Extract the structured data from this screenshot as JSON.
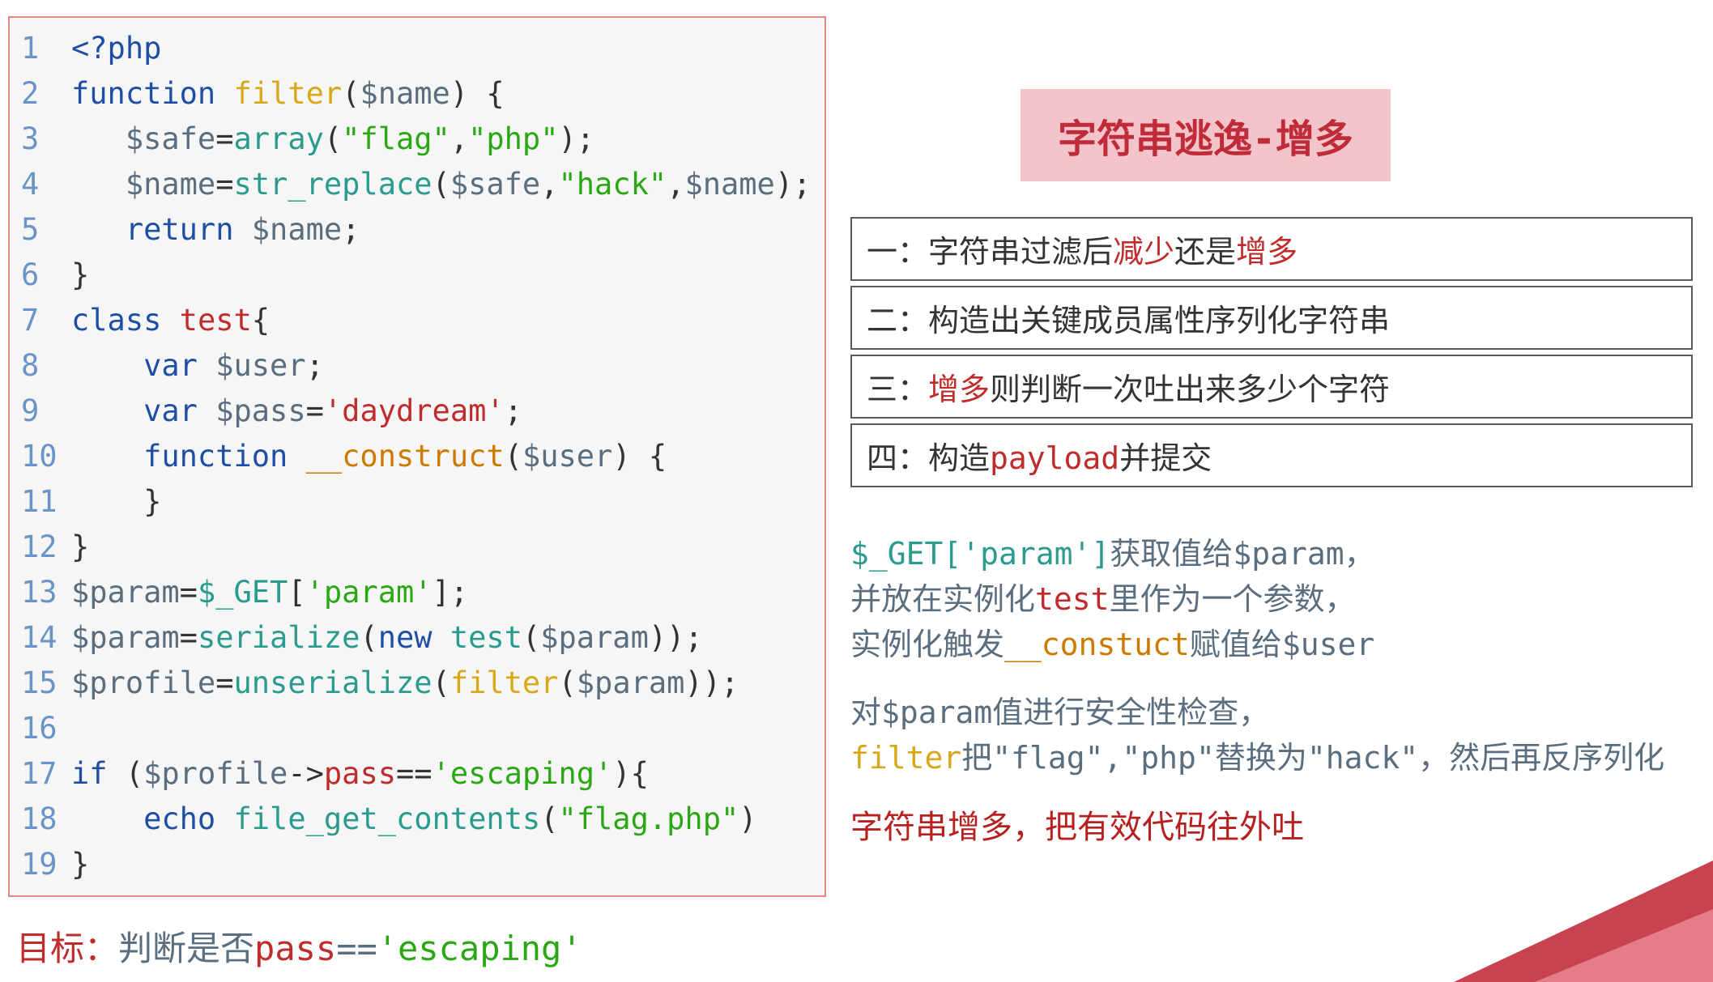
{
  "title_badge": "字符串逃逸-增多",
  "code": {
    "rows": [
      {
        "n": "1",
        "html": "<span class='kw-blue'>&lt;?php</span>"
      },
      {
        "n": "2",
        "html": "<span class='kw-blue'>function</span> <span class='name-gold'>filter</span>(<span class='var-slate'>$name</span>) {"
      },
      {
        "n": "3",
        "html": "   <span class='var-slate'>$safe</span>=<span class='fn-teal'>array</span>(<span class='str-green'>\"flag\"</span>,<span class='str-green'>\"php\"</span>);"
      },
      {
        "n": "4",
        "html": "   <span class='var-slate'>$name</span>=<span class='fn-teal'>str_replace</span>(<span class='var-slate'>$safe</span>,<span class='str-green'>\"hack\"</span>,<span class='var-slate'>$name</span>);"
      },
      {
        "n": "5",
        "html": "   <span class='kw-blue'>return</span> <span class='var-slate'>$name</span>;"
      },
      {
        "n": "6",
        "html": "}"
      },
      {
        "n": "7",
        "html": "<span class='kw-blue'>class</span> <span class='name-red'>test</span>{"
      },
      {
        "n": "8",
        "html": "    <span class='kw-blue'>var</span> <span class='var-slate'>$user</span>;"
      },
      {
        "n": "9",
        "html": "    <span class='kw-blue'>var</span> <span class='var-slate'>$pass</span>=<span class='name-red'>'daydream'</span>;"
      },
      {
        "n": "10",
        "html": "    <span class='kw-blue'>function</span> <span class='name-orange'>__construct</span>(<span class='var-slate'>$user</span>) {"
      },
      {
        "n": "11",
        "html": "    }"
      },
      {
        "n": "12",
        "html": "}"
      },
      {
        "n": "13",
        "html": "<span class='var-slate'>$param</span>=<span class='fn-teal'>$_GET</span>[<span class='str-green'>'param'</span>];"
      },
      {
        "n": "14",
        "html": "<span class='var-slate'>$param</span>=<span class='fn-teal'>serialize</span>(<span class='kw-blue'>new</span> <span class='fn-teal'>test</span>(<span class='var-slate'>$param</span>));"
      },
      {
        "n": "15",
        "html": "<span class='var-slate'>$profile</span>=<span class='fn-teal'>unserialize</span>(<span class='name-gold'>filter</span>(<span class='var-slate'>$param</span>));"
      },
      {
        "n": "16",
        "html": ""
      },
      {
        "n": "17",
        "html": "<span class='kw-blue'>if</span> (<span class='var-slate'>$profile</span>-&gt;<span class='name-red'>pass</span>==<span class='str-green'>'escaping'</span>){"
      },
      {
        "n": "18",
        "html": "    <span class='kw-blue'>echo</span> <span class='fn-teal'>file_get_contents</span>(<span class='str-green'>\"flag.php\"</span>)"
      },
      {
        "n": "19",
        "html": "}"
      }
    ]
  },
  "steps": [
    {
      "num": "一：",
      "parts": [
        {
          "t": "字符串过滤后"
        },
        {
          "t": "减少",
          "cls": "hl-red"
        },
        {
          "t": "还是"
        },
        {
          "t": "增多",
          "cls": "hl-red"
        }
      ]
    },
    {
      "num": "二：",
      "parts": [
        {
          "t": "构造出关键成员属性序列化字符串"
        }
      ]
    },
    {
      "num": "三：",
      "parts": [
        {
          "t": "增多",
          "cls": "hl-red"
        },
        {
          "t": "则判断一次吐出来多少个字符"
        }
      ]
    },
    {
      "num": "四：",
      "parts": [
        {
          "t": "构造"
        },
        {
          "t": "payload",
          "cls": "hl-red"
        },
        {
          "t": "并提交"
        }
      ]
    }
  ],
  "notes": {
    "p1": {
      "get": "$_GET",
      "param": "['param']",
      "t1": "获取值给",
      "var": "$param",
      "t2": "，",
      "t3": "并放在实例化",
      "test": "test",
      "t4": "里作为一个参数，",
      "t5": "实例化触发",
      "construct": "__constuct",
      "t6": "赋值给",
      "user": "$user"
    },
    "p2": {
      "t1": "对",
      "param": "$param",
      "t2": "值进行安全性检查，",
      "filter": "filter",
      "t3": "把\"flag\",\"php\"替换为\"hack\"，然后再反序列化"
    },
    "summary": "字符串增多，把有效代码往外吐"
  },
  "goal": {
    "label": "目标：",
    "t1": "判断是否",
    "pass": "pass",
    "eq": "==",
    "str": "'escaping'"
  }
}
